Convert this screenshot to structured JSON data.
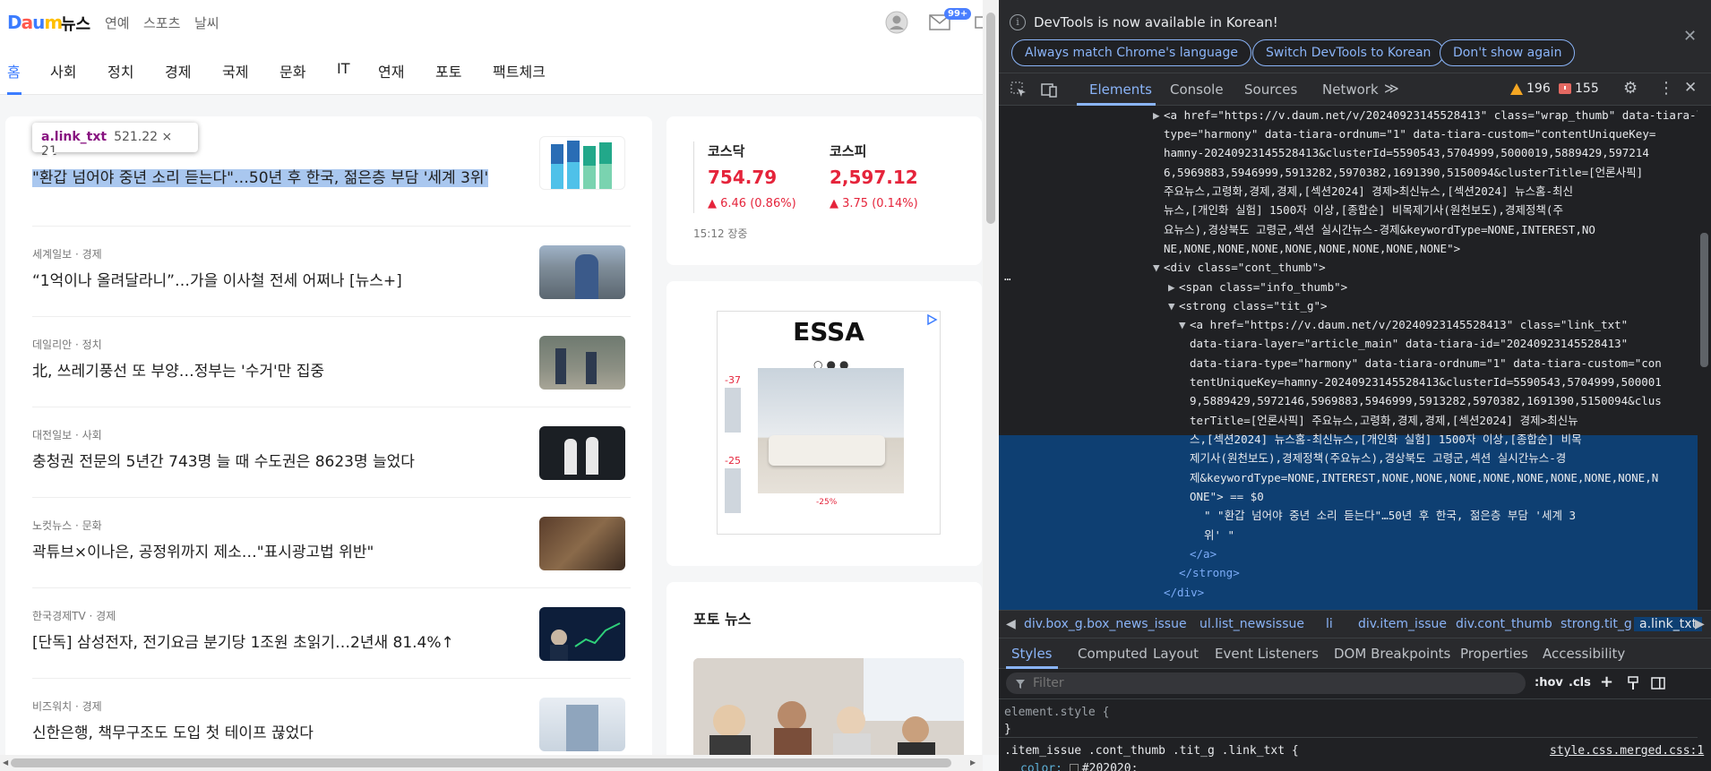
{
  "browser_page": {
    "logo_parts": [
      "D",
      "a",
      "u",
      "m",
      ""
    ],
    "logo_text": "Daum",
    "logo_news": "뉴스",
    "service_links": [
      "연예",
      "스포츠",
      "날씨"
    ],
    "mail_badge": "99+",
    "categories": [
      "홈",
      "사회",
      "정치",
      "경제",
      "국제",
      "문화",
      "IT",
      "연재",
      "포토",
      "팩트체크"
    ],
    "active_category": "홈",
    "inspector_tooltip": {
      "selector": "a.link_txt",
      "size": "521.22 × 21"
    },
    "news": [
      {
        "meta": "",
        "title": "\"환갑 넘어야 중년 소리 듣는다\"…50년 후 한국, 젊은층 부담 '세계 3위'"
      },
      {
        "meta": "세계일보 · 경제",
        "title": "“1억이나 올려달라니”…가을 이사철 전세 어쩌나 [뉴스+]"
      },
      {
        "meta": "데일리안 · 정치",
        "title": "北, 쓰레기풍선 또 부양…정부는 '수거'만 집중"
      },
      {
        "meta": "대전일보 · 사회",
        "title": "충청권 전문의 5년간 743명 늘 때 수도권은 8623명 늘었다"
      },
      {
        "meta": "노컷뉴스 · 문화",
        "title": "곽튜브×이나은, 공정위까지 제소…\"표시광고법 위반\""
      },
      {
        "meta": "한국경제TV · 경제",
        "title": "[단독] 삼성전자, 전기요금 분기당 1조원 초읽기…2년새 81.4%↑"
      },
      {
        "meta": "비즈워치 · 경제",
        "title": "신한은행, 책무구조도 도입 첫 테이프 끊었다"
      }
    ],
    "stocks": [
      {
        "name": "코스닥",
        "value": "754.79",
        "change": "▲ 6.46 (0.86%)"
      },
      {
        "name": "코스피",
        "value": "2,597.12",
        "change": "▲ 3.75 (0.14%)"
      }
    ],
    "stock_time": "15:12 장중",
    "ad": {
      "brand": "ESSA",
      "dots": "○●●",
      "price": "-25%",
      "side_labels": [
        "-37",
        "-25"
      ]
    },
    "photo_news_title": "포토 뉴스"
  },
  "devtools": {
    "info_message": "DevTools is now available in Korean!",
    "info_buttons": [
      "Always match Chrome's language",
      "Switch DevTools to Korean",
      "Don't show again"
    ],
    "tabs": [
      "Elements",
      "Console",
      "Sources",
      "Network"
    ],
    "active_tab": "Elements",
    "warnings": "196",
    "errors": "155",
    "dom_lines": [
      "<a href=\"https://v.daum.net/v/20240923145528413\" class=\"wrap_thumb\" data-tiara-layer=\"article_main\" data-tiara-id=\"20240923145528413\" data-tiara-",
      "type=\"harmony\" data-tiara-ordnum=\"1\" data-tiara-custom=\"contentUniqueKey=",
      "hamny-20240923145528413&clusterId=5590543,5704999,5000019,5889429,597214",
      "6,5969883,5946999,5913282,5970382,1691390,5150094&clusterTitle=[언론사픽]",
      "주요뉴스,고령화,경제,경제,[섹션2024] 경제>최신뉴스,[섹션2024] 뉴스홈-최신",
      "뉴스,[개인화 실험] 1500자 이상,[종합순] 비목제기사(원천보도),경제정책(주",
      "요뉴스),경상북도 고령군,섹션 실시간뉴스-경제&keywordType=NONE,INTEREST,NO",
      "NE,NONE,NONE,NONE,NONE,NONE,NONE,NONE,NONE\">",
      "<div class=\"cont_thumb\">",
      "<span class=\"info_thumb\">",
      "<strong class=\"tit_g\">",
      "<a href=\"https://v.daum.net/v/20240923145528413\" class=\"link_txt\"",
      "data-tiara-layer=\"article_main\" data-tiara-id=\"20240923145528413\"",
      "data-tiara-type=\"harmony\" data-tiara-ordnum=\"1\" data-tiara-custom=\"con",
      "tentUniqueKey=hamny-20240923145528413&clusterId=5590543,5704999,500001",
      "9,5889429,5972146,5969883,5946999,5913282,5970382,1691390,5150094&clus",
      "terTitle=[언론사픽] 주요뉴스,고령화,경제,경제,[섹션2024] 경제>최신뉴",
      "스,[섹션2024] 뉴스홈-최신뉴스,[개인화 실험] 1500자 이상,[종합순] 비목",
      "제기사(원천보도),경제정책(주요뉴스),경상북도 고령군,섹션 실시간뉴스-경",
      "제&keywordType=NONE,INTEREST,NONE,NONE,NONE,NONE,NONE,NONE,NONE,NONE,N",
      "ONE\"> == $0",
      "\" \"환갑 넘어야 중년 소리 듣는다\"…50년 후 한국, 젊은층 부담 '세계 3",
      "위' \"",
      "</a>",
      "</strong>",
      "</div>"
    ],
    "breadcrumbs": [
      "div.box_g.box_news_issue",
      "ul.list_newsissue",
      "li",
      "div.item_issue",
      "div.cont_thumb",
      "strong.tit_g",
      "a.link_txt"
    ],
    "sub_tabs": [
      "Styles",
      "Computed",
      "Layout",
      "Event Listeners",
      "DOM Breakpoints",
      "Properties",
      "Accessibility"
    ],
    "filter_placeholder": "Filter",
    "filter_tools": [
      ":hov",
      ".cls"
    ],
    "style_lines": [
      "element.style {",
      "}",
      ".item_issue .cont_thumb .tit_g .link_txt {",
      "color: ",
      "#202020;"
    ],
    "style_source": "style.css.merged.css:1"
  }
}
